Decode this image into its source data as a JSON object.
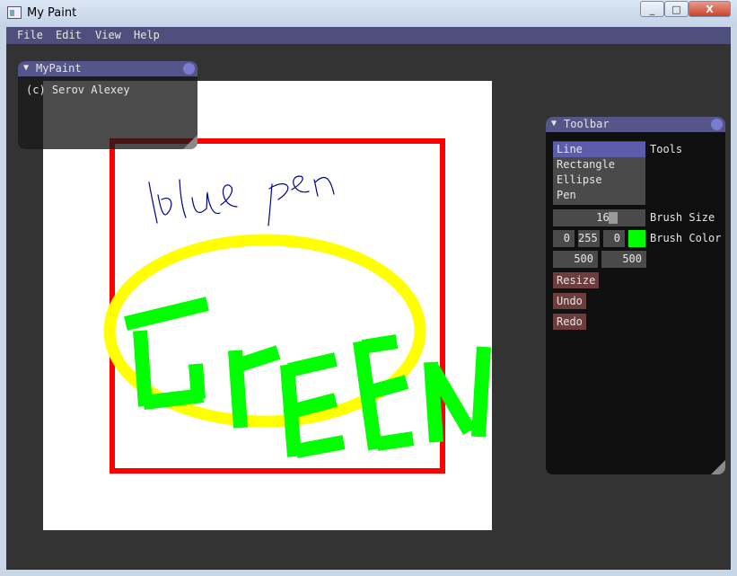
{
  "window": {
    "title": "My Paint",
    "minimize_glyph": "_",
    "maximize_glyph": "□",
    "close_glyph": "X"
  },
  "menu": {
    "items": [
      "File",
      "Edit",
      "View",
      "Help"
    ]
  },
  "mypaint_panel": {
    "title": "MyPaint",
    "text": "(c) Serov Alexey"
  },
  "toolbar_panel": {
    "title": "Tools",
    "header": "Toolbar",
    "tools": [
      "Line",
      "Rectangle",
      "Ellipse",
      "Pen"
    ],
    "selected_tool": "Line",
    "tools_label": "Tools",
    "brush_size": "16",
    "brush_size_label": "Brush Size",
    "brush_size_fraction": 0.13,
    "brush_color": [
      "0",
      "255",
      "0"
    ],
    "brush_color_label": "Brush Color",
    "canvas_size": [
      "500",
      "500"
    ],
    "buttons": {
      "resize": "Resize",
      "undo": "Undo",
      "redo": "Redo"
    }
  },
  "colors": {
    "client_bg": "#333333",
    "menubar": "#4f4f7e",
    "panel_title": "#55558a",
    "selection": "#5c5cab",
    "button": "#6b3d3d",
    "swatch": "#00ff00",
    "rect_stroke": "#ff0000",
    "ellipse_stroke": "#ffff00",
    "pen_stroke": "#00008b",
    "green_stroke": "#00ff00"
  },
  "icons": {
    "collapse": "triangle-down-icon",
    "window_close": "close-icon"
  }
}
